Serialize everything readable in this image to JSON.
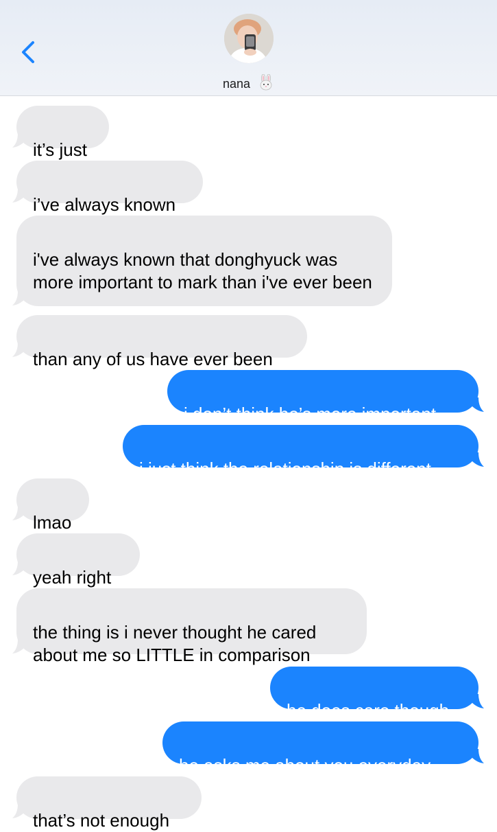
{
  "header": {
    "contact_name": "nana",
    "contact_emoji": "rabbit-face-icon",
    "back_icon": "chevron-left-icon"
  },
  "colors": {
    "incoming_bubble": "#e9e9eb",
    "outgoing_bubble": "#1b84fe",
    "back_chevron": "#1b84fe",
    "header_bg": "#eaeef5"
  },
  "messages": [
    {
      "direction": "incoming",
      "text": "it’s just"
    },
    {
      "direction": "incoming",
      "text": "i’ve always known"
    },
    {
      "direction": "incoming",
      "text": "i've always known that donghyuck was more important to mark than i've ever been"
    },
    {
      "direction": "incoming",
      "text": "than any of us have ever been"
    },
    {
      "direction": "outgoing",
      "text": "i don’t think he’s more important"
    },
    {
      "direction": "outgoing",
      "text": "i just think the relationship is different"
    },
    {
      "direction": "incoming",
      "text": "lmao"
    },
    {
      "direction": "incoming",
      "text": "yeah right"
    },
    {
      "direction": "incoming",
      "text": "the thing is i never thought he cared about me so LITTLE in comparison"
    },
    {
      "direction": "outgoing",
      "text": "he does care though"
    },
    {
      "direction": "outgoing",
      "text": "he asks me about you everyday..."
    },
    {
      "direction": "incoming",
      "text": "that’s not enough"
    }
  ]
}
